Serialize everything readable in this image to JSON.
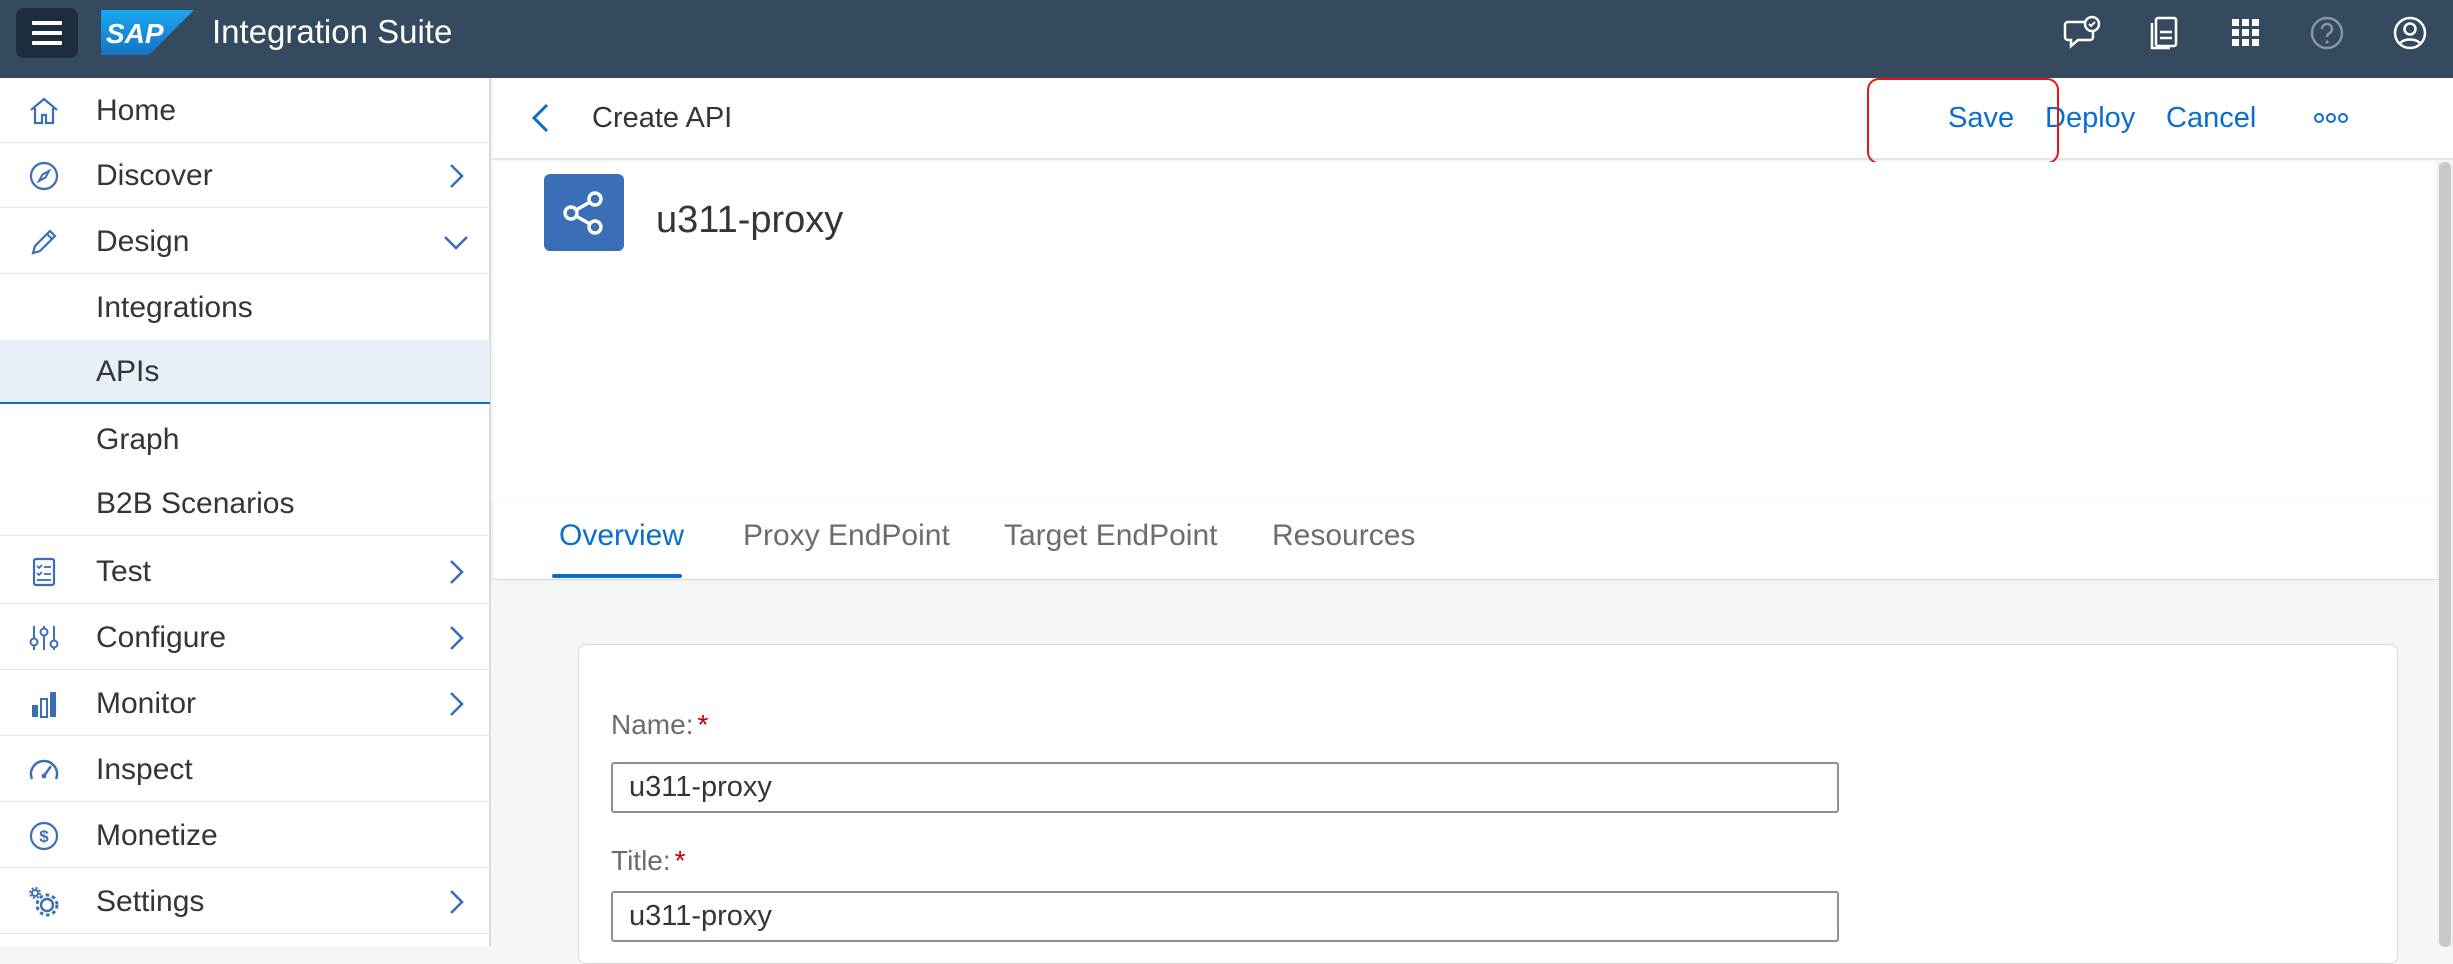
{
  "shell": {
    "logo_text": "SAP",
    "app_title": "Integration Suite",
    "icons": [
      "feedback-icon",
      "notifications-icon",
      "app-launcher-icon",
      "help-icon",
      "user-profile-icon"
    ]
  },
  "sidebar": {
    "items": [
      {
        "label": "Home",
        "icon": "home-icon"
      },
      {
        "label": "Discover",
        "icon": "compass-icon"
      },
      {
        "label": "Design",
        "icon": "pencil-icon"
      },
      {
        "label": "Test",
        "icon": "checklist-icon"
      },
      {
        "label": "Configure",
        "icon": "sliders-icon"
      },
      {
        "label": "Monitor",
        "icon": "bar-chart-icon"
      },
      {
        "label": "Inspect",
        "icon": "gauge-icon"
      },
      {
        "label": "Monetize",
        "icon": "money-icon"
      },
      {
        "label": "Settings",
        "icon": "gears-icon"
      }
    ],
    "design_subitems": [
      {
        "label": "Integrations"
      },
      {
        "label": "APIs",
        "selected": true
      },
      {
        "label": "Graph"
      },
      {
        "label": "B2B Scenarios"
      }
    ]
  },
  "header": {
    "page_title": "Create API",
    "actions": {
      "save": "Save",
      "deploy": "Deploy",
      "cancel": "Cancel"
    }
  },
  "object": {
    "title": "u311-proxy"
  },
  "tabs": [
    {
      "label": "Overview",
      "active": true
    },
    {
      "label": "Proxy EndPoint"
    },
    {
      "label": "Target EndPoint"
    },
    {
      "label": "Resources"
    }
  ],
  "form": {
    "name_label": "Name:",
    "name_value": "u311-proxy",
    "title_label": "Title:",
    "title_value": "u311-proxy",
    "required_marker": "*"
  },
  "colors": {
    "shell": "#354a5f",
    "accent": "#0a6ed1",
    "highlight": "#e8141a"
  }
}
